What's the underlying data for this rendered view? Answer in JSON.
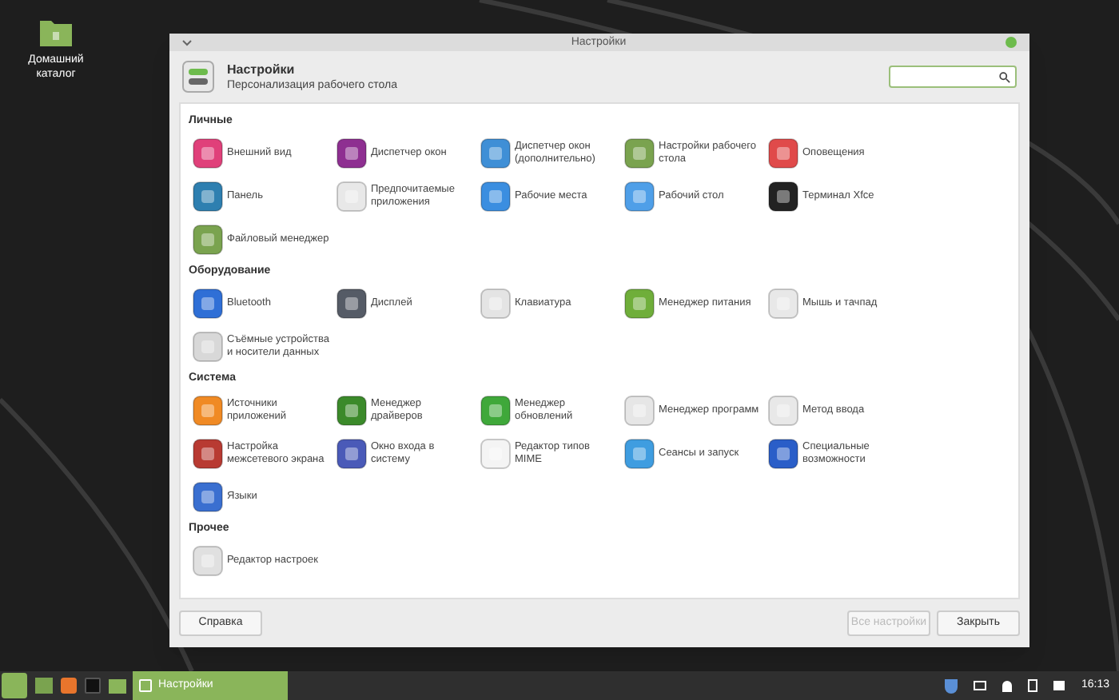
{
  "desktop": {
    "icons": [
      {
        "label": "Домашний каталог"
      }
    ]
  },
  "window": {
    "title": "Настройки",
    "header": {
      "title": "Настройки",
      "subtitle": "Персонализация рабочего стола"
    },
    "sections": [
      {
        "title": "Личные",
        "items": [
          {
            "label": "Внешний вид"
          },
          {
            "label": "Диспетчер окон"
          },
          {
            "label": "Диспетчер окон (дополнительно)"
          },
          {
            "label": "Настройки рабочего стола"
          },
          {
            "label": "Оповещения"
          },
          {
            "label": "Панель"
          },
          {
            "label": "Предпочитаемые приложения"
          },
          {
            "label": "Рабочие места"
          },
          {
            "label": "Рабочий стол"
          },
          {
            "label": "Терминал Xfce"
          },
          {
            "label": "Файловый менеджер"
          }
        ]
      },
      {
        "title": "Оборудование",
        "items": [
          {
            "label": "Bluetooth"
          },
          {
            "label": "Дисплей"
          },
          {
            "label": "Клавиатура"
          },
          {
            "label": "Менеджер питания"
          },
          {
            "label": "Мышь и тачпад"
          },
          {
            "label": "Съёмные устройства и носители данных"
          }
        ]
      },
      {
        "title": "Система",
        "items": [
          {
            "label": "Источники приложений"
          },
          {
            "label": "Менеджер драйверов"
          },
          {
            "label": "Менеджер обновлений"
          },
          {
            "label": "Менеджер программ"
          },
          {
            "label": "Метод ввода"
          },
          {
            "label": "Настройка межсетевого экрана"
          },
          {
            "label": "Окно входа в систему"
          },
          {
            "label": "Редактор типов MIME"
          },
          {
            "label": "Сеансы и запуск"
          },
          {
            "label": "Специальные возможности"
          },
          {
            "label": "Языки"
          }
        ]
      },
      {
        "title": "Прочее",
        "items": [
          {
            "label": "Редактор настроек"
          }
        ]
      }
    ],
    "buttons": [
      {
        "label": "Справка",
        "disabled": false
      },
      {
        "label": "Все настройки",
        "disabled": true
      },
      {
        "label": "Закрыть",
        "disabled": false
      }
    ]
  },
  "taskbar": {
    "tasks": [
      {
        "label": "Настройки",
        "selected": true
      }
    ],
    "clock": "16:13"
  }
}
